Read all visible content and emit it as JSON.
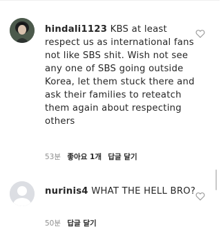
{
  "comments": [
    {
      "username": "hindali1123",
      "text": "KBS at least respect us as international fans not like SBS shit. Wish not see any one of SBS going outside Korea,  let them stuck there and ask their families to reteatch them again about respecting others",
      "time": "53분",
      "likes": "좋아요 1개",
      "reply": "답글 달기",
      "avatar_icon": "profile-photo",
      "like_icon": "heart-outline-icon"
    },
    {
      "username": "nurinis4",
      "text": "WHAT THE HELL BRO?",
      "time": "50분",
      "reply": "답글 달기",
      "avatar_icon": "default-avatar",
      "like_icon": "heart-outline-icon"
    }
  ],
  "colors": {
    "text": "#262626",
    "secondary": "#8e8e8e",
    "heart": "#999999"
  }
}
